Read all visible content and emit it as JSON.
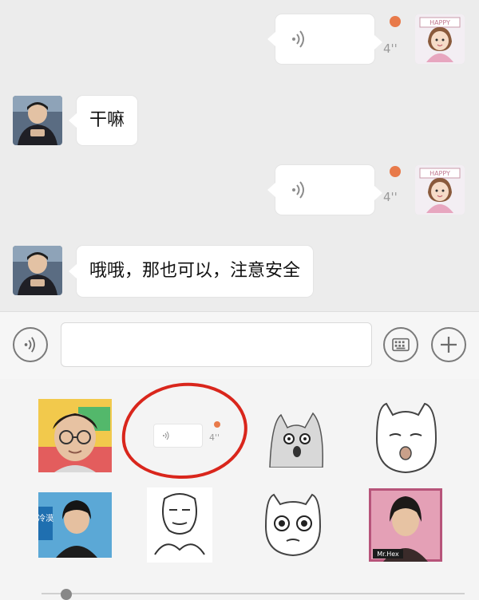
{
  "messages": [
    {
      "side": "right",
      "type": "voice",
      "duration": "4''",
      "unread": true
    },
    {
      "side": "left",
      "type": "text",
      "text": "干嘛"
    },
    {
      "side": "right",
      "type": "voice",
      "duration": "4''",
      "unread": true
    },
    {
      "side": "left",
      "type": "text",
      "text": "哦哦，那也可以，注意安全"
    }
  ],
  "sticker_panel": {
    "highlighted_voice_duration": "4''",
    "sticker_labels": [
      "HAPPY",
      "Mr.Hex",
      "冷漠"
    ]
  },
  "avatars": {
    "me_label": "HAPPY"
  },
  "colors": {
    "unread_dot": "#e87a4a",
    "highlight_circle": "#d9261c",
    "bubble": "#ffffff"
  }
}
